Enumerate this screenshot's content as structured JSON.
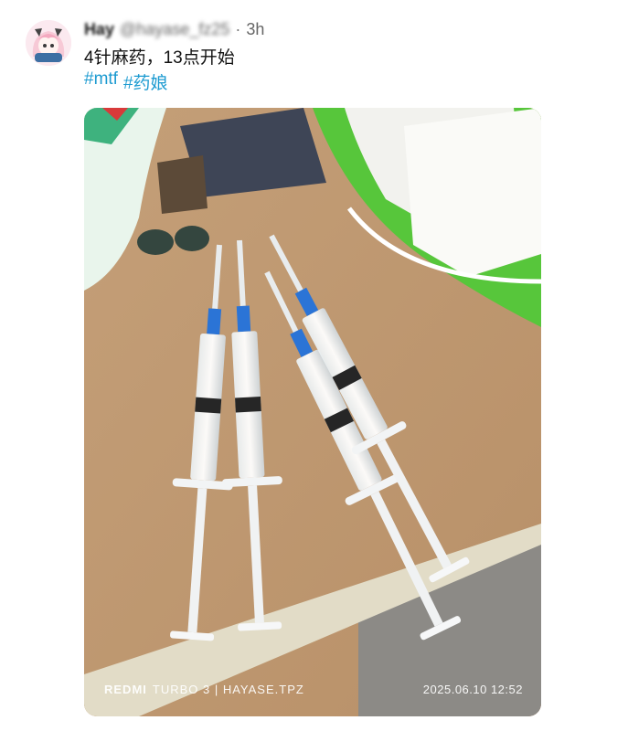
{
  "post": {
    "author": {
      "display_name": "Hay",
      "handle": "@hayase_fz25",
      "avatar_icon": "anime-avatar-icon"
    },
    "separator": "·",
    "timestamp": "3h",
    "text": "4针麻药，13点开始",
    "hashtags": [
      "#mtf",
      "#药娘"
    ]
  },
  "media": {
    "watermark": {
      "brand": "REDMI",
      "model": "TURBO 3 | HAYASE.TPZ",
      "datetime": "2025.06.10 12:52"
    }
  },
  "colors": {
    "hashtag": "#1d9bd1",
    "accent_green": "#57c63b",
    "syringe_blue": "#2b74d6"
  }
}
